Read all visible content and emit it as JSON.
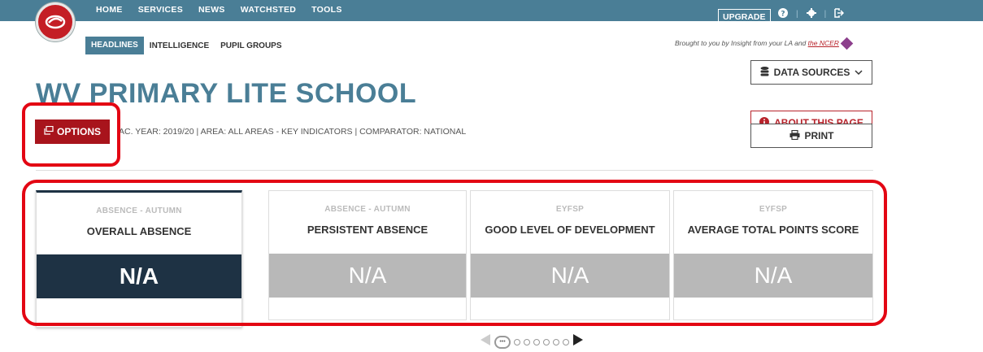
{
  "nav": {
    "main": [
      "HOME",
      "SERVICES",
      "NEWS",
      "WATCHSTED",
      "TOOLS"
    ],
    "sub": [
      "HEADLINES",
      "INTELLIGENCE",
      "PUPIL GROUPS"
    ],
    "upgrade": "UPGRADE",
    "brought_by_prefix": "Brought to you by Insight from your LA and ",
    "brought_by_link": "the NCER"
  },
  "header": {
    "title": "WV PRIMARY LITE SCHOOL",
    "options_label": "OPTIONS",
    "context": "AC. YEAR: 2019/20 | AREA: ALL AREAS - KEY INDICATORS | COMPARATOR: NATIONAL",
    "data_sources_label": "DATA SOURCES",
    "about_label": "ABOUT THIS PAGE",
    "print_label": "PRINT"
  },
  "cards": [
    {
      "category": "ABSENCE - AUTUMN",
      "title": "OVERALL ABSENCE",
      "value": "N/A"
    },
    {
      "category": "ABSENCE - AUTUMN",
      "title": "PERSISTENT ABSENCE",
      "value": "N/A"
    },
    {
      "category": "EYFSP",
      "title": "GOOD LEVEL OF DEVELOPMENT",
      "value": "N/A"
    },
    {
      "category": "EYFSP",
      "title": "AVERAGE TOTAL POINTS SCORE",
      "value": "N/A"
    }
  ],
  "pager": {
    "current_label": "•••",
    "dots": 6
  },
  "colors": {
    "nav": "#4a7e96",
    "brand_red": "#a8141c",
    "active_card": "#1e3244",
    "annotation": "#e30613"
  }
}
